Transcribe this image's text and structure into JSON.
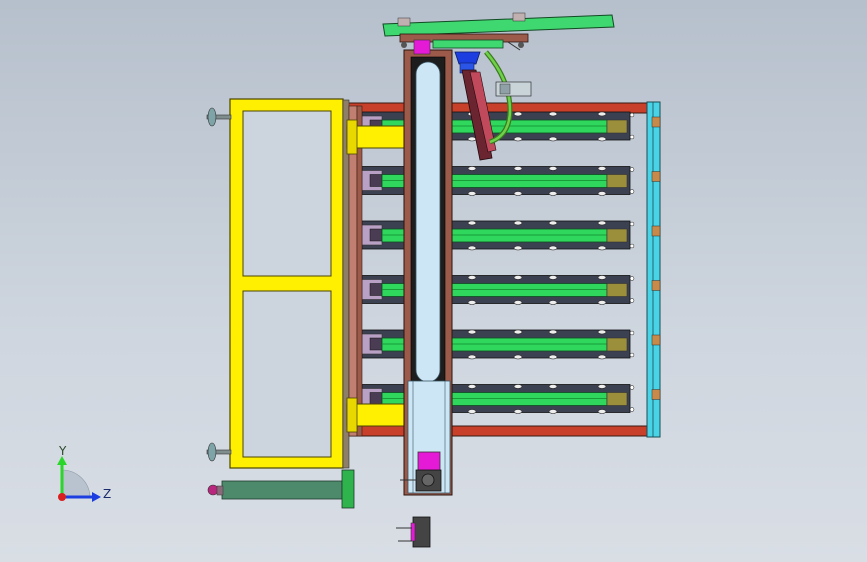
{
  "viewport": {
    "background_top": "#b6c0cc",
    "background_bottom": "#d9dee5"
  },
  "triad": {
    "y_label": "Y",
    "z_label": "Z",
    "y_color": "#2bd62b",
    "z_color": "#1c3ee0",
    "x_color": "#d81e1e"
  },
  "model": {
    "frame_color": "#ffef00",
    "rail_color": "#1fd155",
    "beam_color": "#c8402a",
    "column_color": "#9b5a4a",
    "column_inner_color": "#cde6f5",
    "bracket_color": "#cfa0c8",
    "arm_color": "#3fd76f",
    "end_rail_color": "#48d3e6",
    "lane_count": 6
  }
}
